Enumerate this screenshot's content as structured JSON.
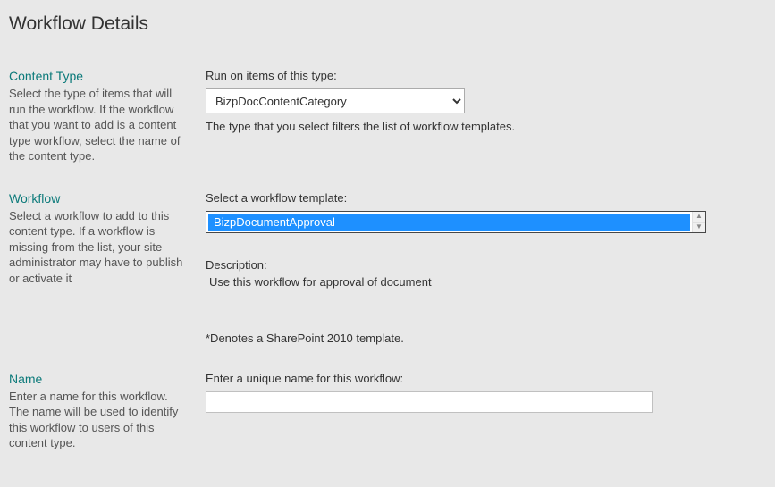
{
  "page_title": "Workflow Details",
  "content_type": {
    "heading": "Content Type",
    "description": "Select the type of items that will run the workflow. If the workflow that you want to add is a content type workflow, select the name of the content type.",
    "field_label": "Run on items of this type:",
    "selected": "BizpDocContentCategory",
    "help": "The type that you select filters the list of workflow templates."
  },
  "workflow": {
    "heading": "Workflow",
    "description": "Select a workflow to add to this content type. If a workflow is missing from the list, your site administrator may have to publish or activate it",
    "field_label": "Select a workflow template:",
    "selected_template": "BizpDocumentApproval",
    "desc_label": "Description:",
    "desc_text": "Use this workflow for approval of document",
    "footnote": "*Denotes a SharePoint 2010 template."
  },
  "name": {
    "heading": "Name",
    "description": "Enter a name for this workflow. The name will be used to identify this workflow to users of this content type.",
    "field_label": "Enter a unique name for this workflow:",
    "value": ""
  }
}
